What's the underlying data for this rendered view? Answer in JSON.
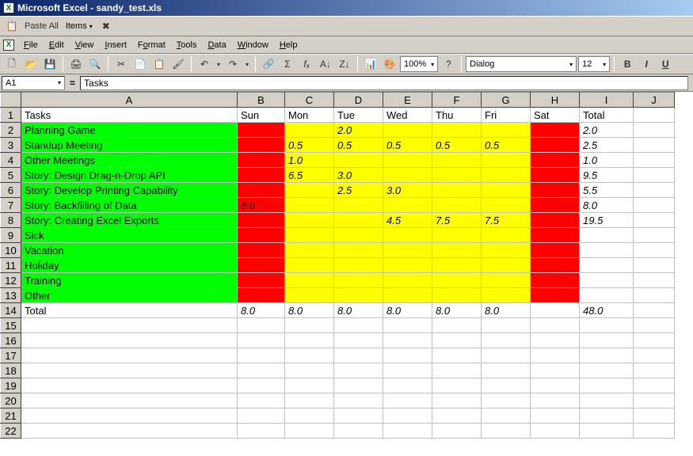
{
  "title": "Microsoft Excel - sandy_test.xls",
  "clipbar": {
    "paste": "Paste All",
    "items": "Items"
  },
  "menus": [
    "File",
    "Edit",
    "View",
    "Insert",
    "Format",
    "Tools",
    "Data",
    "Window",
    "Help"
  ],
  "namebox": "A1",
  "formula": "Tasks",
  "toolbar": {
    "zoom": "100%",
    "font": "Dialog",
    "size": "12"
  },
  "columns": [
    "A",
    "B",
    "C",
    "D",
    "E",
    "F",
    "G",
    "H",
    "I",
    "J"
  ],
  "headers": {
    "A": "Tasks",
    "B": "Sun",
    "C": "Mon",
    "D": "Tue",
    "E": "Wed",
    "F": "Thu",
    "G": "Fri",
    "H": "Sat",
    "I": "Total"
  },
  "rows": [
    {
      "n": 2,
      "label": "Planning Game",
      "d": [
        "",
        "",
        "2.0",
        "",
        "",
        "",
        "",
        "2.0"
      ]
    },
    {
      "n": 3,
      "label": "Standup Meeting",
      "d": [
        "",
        "0.5",
        "0.5",
        "0.5",
        "0.5",
        "0.5",
        "",
        "2.5"
      ]
    },
    {
      "n": 4,
      "label": "Other Meetings",
      "d": [
        "",
        "1.0",
        "",
        "",
        "",
        "",
        "",
        "1.0"
      ]
    },
    {
      "n": 5,
      "label": "Story: Design Drag-n-Drop API",
      "d": [
        "",
        "6.5",
        "3.0",
        "",
        "",
        "",
        "",
        "9.5"
      ]
    },
    {
      "n": 6,
      "label": "Story: Develop Printing Capability",
      "d": [
        "",
        "",
        "2.5",
        "3.0",
        "",
        "",
        "",
        "5.5"
      ]
    },
    {
      "n": 7,
      "label": "Story: Backfilling of Data",
      "d": [
        "8.0",
        "",
        "",
        "",
        "",
        "",
        "",
        "8.0"
      ]
    },
    {
      "n": 8,
      "label": "Story: Creating Excel Exports",
      "d": [
        "",
        "",
        "",
        "4.5",
        "7.5",
        "7.5",
        "",
        "19.5"
      ]
    },
    {
      "n": 9,
      "label": "Sick",
      "d": [
        "",
        "",
        "",
        "",
        "",
        "",
        "",
        ""
      ]
    },
    {
      "n": 10,
      "label": "Vacation",
      "d": [
        "",
        "",
        "",
        "",
        "",
        "",
        "",
        ""
      ]
    },
    {
      "n": 11,
      "label": "Holiday",
      "d": [
        "",
        "",
        "",
        "",
        "",
        "",
        "",
        ""
      ]
    },
    {
      "n": 12,
      "label": "Training",
      "d": [
        "",
        "",
        "",
        "",
        "",
        "",
        "",
        ""
      ]
    },
    {
      "n": 13,
      "label": "Other",
      "d": [
        "",
        "",
        "",
        "",
        "",
        "",
        "",
        ""
      ]
    }
  ],
  "totals": {
    "n": 14,
    "label": "Total",
    "d": [
      "8.0",
      "8.0",
      "8.0",
      "8.0",
      "8.0",
      "8.0",
      "",
      "48.0"
    ]
  },
  "emptyRows": [
    15,
    16,
    17,
    18,
    19,
    20,
    21,
    22
  ],
  "chart_data": {
    "type": "table",
    "title": "Tasks timesheet",
    "columns": [
      "Tasks",
      "Sun",
      "Mon",
      "Tue",
      "Wed",
      "Thu",
      "Fri",
      "Sat",
      "Total"
    ],
    "rows": [
      [
        "Planning Game",
        null,
        null,
        2.0,
        null,
        null,
        null,
        null,
        2.0
      ],
      [
        "Standup Meeting",
        null,
        0.5,
        0.5,
        0.5,
        0.5,
        0.5,
        null,
        2.5
      ],
      [
        "Other Meetings",
        null,
        1.0,
        null,
        null,
        null,
        null,
        null,
        1.0
      ],
      [
        "Story: Design Drag-n-Drop API",
        null,
        6.5,
        3.0,
        null,
        null,
        null,
        null,
        9.5
      ],
      [
        "Story: Develop Printing Capability",
        null,
        null,
        2.5,
        3.0,
        null,
        null,
        null,
        5.5
      ],
      [
        "Story: Backfilling of Data",
        8.0,
        null,
        null,
        null,
        null,
        null,
        null,
        8.0
      ],
      [
        "Story: Creating Excel Exports",
        null,
        null,
        null,
        4.5,
        7.5,
        7.5,
        null,
        19.5
      ],
      [
        "Sick",
        null,
        null,
        null,
        null,
        null,
        null,
        null,
        null
      ],
      [
        "Vacation",
        null,
        null,
        null,
        null,
        null,
        null,
        null,
        null
      ],
      [
        "Holiday",
        null,
        null,
        null,
        null,
        null,
        null,
        null,
        null
      ],
      [
        "Training",
        null,
        null,
        null,
        null,
        null,
        null,
        null,
        null
      ],
      [
        "Other",
        null,
        null,
        null,
        null,
        null,
        null,
        null,
        null
      ],
      [
        "Total",
        8.0,
        8.0,
        8.0,
        8.0,
        8.0,
        8.0,
        null,
        48.0
      ]
    ]
  }
}
